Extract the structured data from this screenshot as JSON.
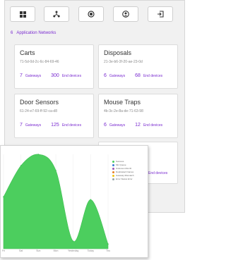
{
  "toolbar": {
    "icons": [
      "dashboard-icon",
      "network-icon",
      "target-icon",
      "user-icon",
      "logout-icon"
    ]
  },
  "heading": {
    "count": "6",
    "label": "Application Networks"
  },
  "cards": [
    {
      "title": "Carts",
      "id": "71-5d-0d-2c-6c-84-69-46",
      "gateways": "7",
      "gateways_label": "Gateways",
      "devices": "300",
      "devices_label": "End devices"
    },
    {
      "title": "Disposals",
      "id": "21-3e-b6-3f-20-ae-23-0d",
      "gateways": "6",
      "gateways_label": "Gateways",
      "devices": "68",
      "devices_label": "End devices"
    },
    {
      "title": "Door Sensors",
      "id": "61-24-e7-69-ff-92-ca-d8",
      "gateways": "7",
      "gateways_label": "Gateways",
      "devices": "125",
      "devices_label": "End devices"
    },
    {
      "title": "Mouse Traps",
      "id": "4b-3c-2e-8a-de-71-63-98",
      "gateways": "6",
      "gateways_label": "Gateways",
      "devices": "12",
      "devices_label": "End devices"
    },
    {
      "title": "",
      "id": "",
      "gateways": "",
      "gateways_label": "",
      "devices": "",
      "devices_label": "End devices"
    }
  ],
  "chart_data": {
    "type": "area",
    "x": [
      "Fri",
      "Sat",
      "Sun",
      "Mon",
      "Yesterday",
      "Today",
      "Thu"
    ],
    "series": [
      {
        "name": "Success",
        "color": "#4cce5e",
        "values": [
          55,
          88,
          100,
          83,
          8,
          52,
          5
        ]
      }
    ],
    "legend": [
      {
        "name": "Success",
        "color": "#4cce5e"
      },
      {
        "name": "Mic Queue",
        "color": "#3a7bd5"
      },
      {
        "name": "Unknown Mot ID",
        "color": "#9b59b6"
      },
      {
        "name": "Duplicated Frames",
        "color": "#e67e22"
      },
      {
        "name": "Gateway Mismatch",
        "color": "#f1c40f"
      },
      {
        "name": "Error Status Error",
        "color": "#95a5a6"
      }
    ]
  }
}
